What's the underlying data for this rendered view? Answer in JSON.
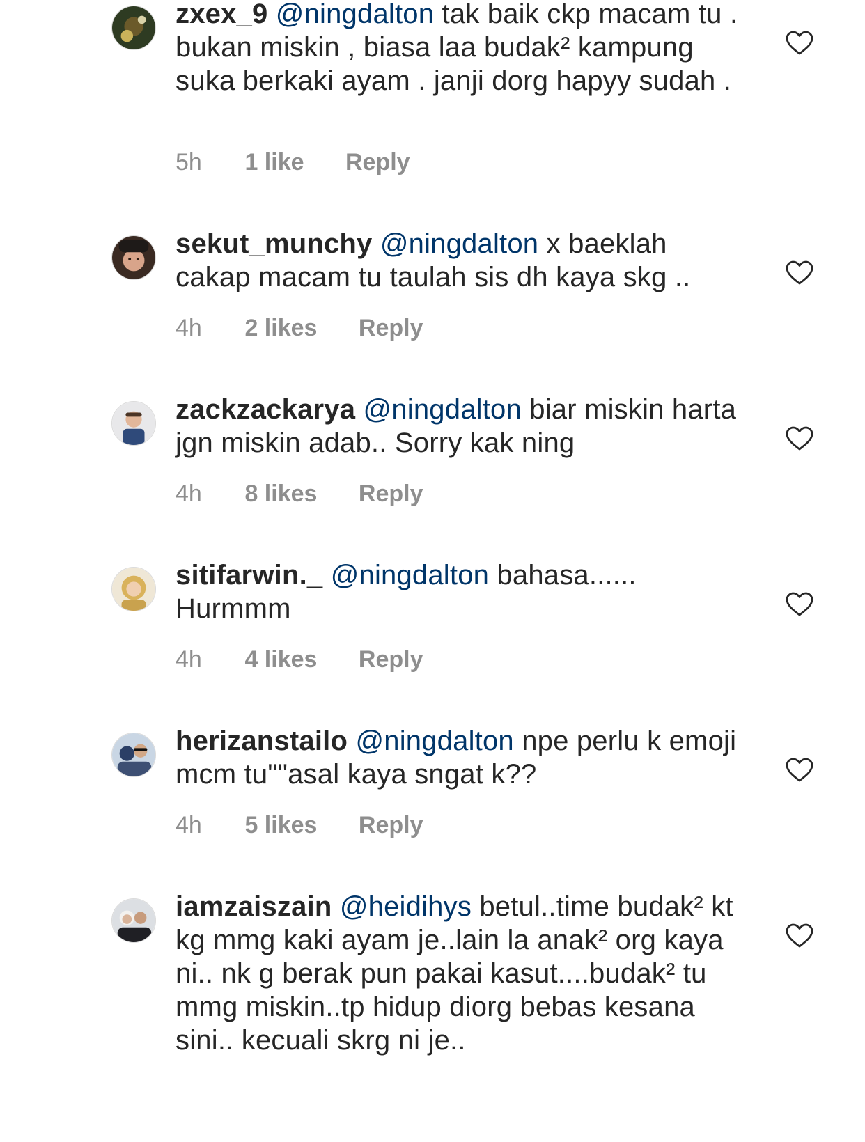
{
  "comments": [
    {
      "username": "zxex_9",
      "mention": "@ningdalton",
      "text": " tak baik ckp macam tu . bukan miskin , biasa laa budak² kampung suka berkaki ayam . janji dorg hapyy sudah .",
      "time": "5h",
      "likes": "1 like",
      "reply": "Reply",
      "avatar_colors": [
        "#2e3b22",
        "#c9b25a"
      ]
    },
    {
      "username": "sekut_munchy",
      "mention": "@ningdalton",
      "text": "  x baeklah cakap macam tu taulah sis dh kaya skg ..",
      "time": "4h",
      "likes": "2 likes",
      "reply": "Reply",
      "avatar_colors": [
        "#3a2a22",
        "#d8a48a"
      ]
    },
    {
      "username": "zackzackarya",
      "mention": "@ningdalton",
      "text": " biar miskin harta jgn miskin adab.. Sorry kak ning",
      "time": "4h",
      "likes": "8 likes",
      "reply": "Reply",
      "avatar_colors": [
        "#e8e8ea",
        "#2f4a7a"
      ]
    },
    {
      "username": "sitifarwin._",
      "mention": "@ningdalton",
      "text": " bahasa...... Hurmmm",
      "time": "4h",
      "likes": "4 likes",
      "reply": "Reply",
      "avatar_colors": [
        "#efe7d6",
        "#d9b25b"
      ]
    },
    {
      "username": "herizanstailo",
      "mention": "@ningdalton",
      "text": " npe perlu k emoji mcm tu\"\"asal kaya sngat k??",
      "time": "4h",
      "likes": "5 likes",
      "reply": "Reply",
      "avatar_colors": [
        "#c9d6e4",
        "#2b3f66"
      ]
    },
    {
      "username": "iamzaiszain",
      "mention": "@heidihys",
      "text": " betul..time budak² kt kg mmg kaki ayam je..lain la anak² org kaya ni.. nk g berak pun pakai kasut....budak² tu mmg miskin..tp hidup diorg bebas kesana sini.. kecuali skrg ni je..",
      "time": "",
      "likes": "",
      "reply": "",
      "avatar_colors": [
        "#dcdfe3",
        "#1f1f24"
      ]
    }
  ],
  "accent": "#003569",
  "muted": "#8e8e8e",
  "icons": {
    "like": "heart-outline-icon"
  }
}
